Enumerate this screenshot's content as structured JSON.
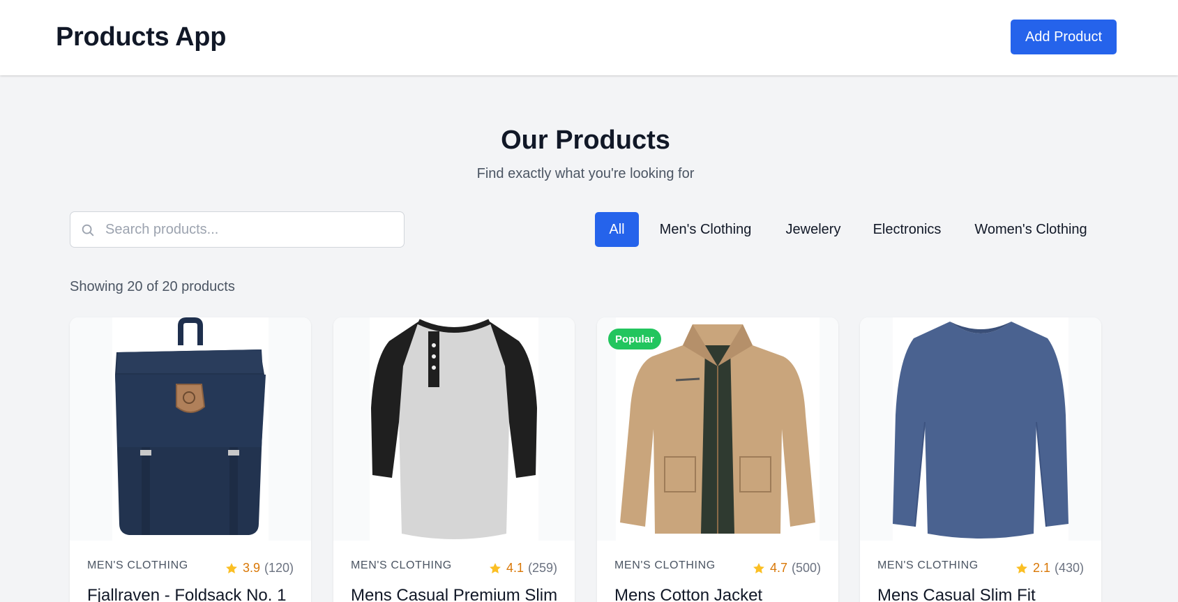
{
  "header": {
    "app_title": "Products App",
    "add_button_label": "Add Product"
  },
  "hero": {
    "title": "Our Products",
    "subtitle": "Find exactly what you're looking for"
  },
  "search": {
    "placeholder": "Search products...",
    "value": ""
  },
  "filters": [
    {
      "label": "All",
      "active": true
    },
    {
      "label": "Men's Clothing",
      "active": false
    },
    {
      "label": "Jewelery",
      "active": false
    },
    {
      "label": "Electronics",
      "active": false
    },
    {
      "label": "Women's Clothing",
      "active": false
    }
  ],
  "results": {
    "count_text": "Showing 20 of 20 products"
  },
  "products": [
    {
      "category": "MEN'S CLOTHING",
      "rating": "3.9",
      "reviews": "(120)",
      "title": "Fjallraven - Foldsack No. 1",
      "image_icon": "backpack-image",
      "badge": ""
    },
    {
      "category": "MEN'S CLOTHING",
      "rating": "4.1",
      "reviews": "(259)",
      "title": "Mens Casual Premium Slim",
      "image_icon": "raglan-shirt-image",
      "badge": ""
    },
    {
      "category": "MEN'S CLOTHING",
      "rating": "4.7",
      "reviews": "(500)",
      "title": "Mens Cotton Jacket",
      "image_icon": "jacket-image",
      "badge": "Popular"
    },
    {
      "category": "MEN'S CLOTHING",
      "rating": "2.1",
      "reviews": "(430)",
      "title": "Mens Casual Slim Fit",
      "image_icon": "long-sleeve-shirt-image",
      "badge": ""
    }
  ],
  "colors": {
    "primary": "#2563eb",
    "badge": "#22c55e",
    "star": "#fbbf24",
    "rating_text": "#d97706"
  }
}
